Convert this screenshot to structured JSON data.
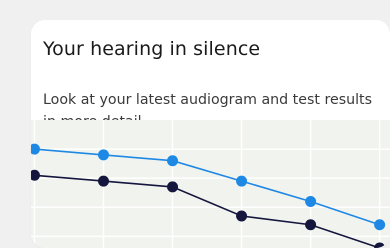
{
  "card": {
    "title": "Your hearing in silence",
    "description": "Look at your latest audiogram and test results in more detail."
  },
  "colors": {
    "background": "#f0f0f0",
    "card": "#ffffff",
    "chart_background": "#f1f3ee",
    "gridline": "#ffffff",
    "series_right": "#1e88e5",
    "series_left": "#14163d"
  },
  "chart_data": {
    "type": "line",
    "grid": true,
    "x": [
      0,
      1,
      2,
      3,
      4,
      5
    ],
    "series": [
      {
        "color": "#1e88e5",
        "values": [
          0,
          1,
          2,
          5.5,
          9,
          13
        ]
      },
      {
        "color": "#14163d",
        "values": [
          4.5,
          5.5,
          6.5,
          11.5,
          13,
          17
        ]
      }
    ],
    "xlim": [
      -0.05,
      5.15
    ],
    "ylim": [
      -5,
      17
    ]
  }
}
